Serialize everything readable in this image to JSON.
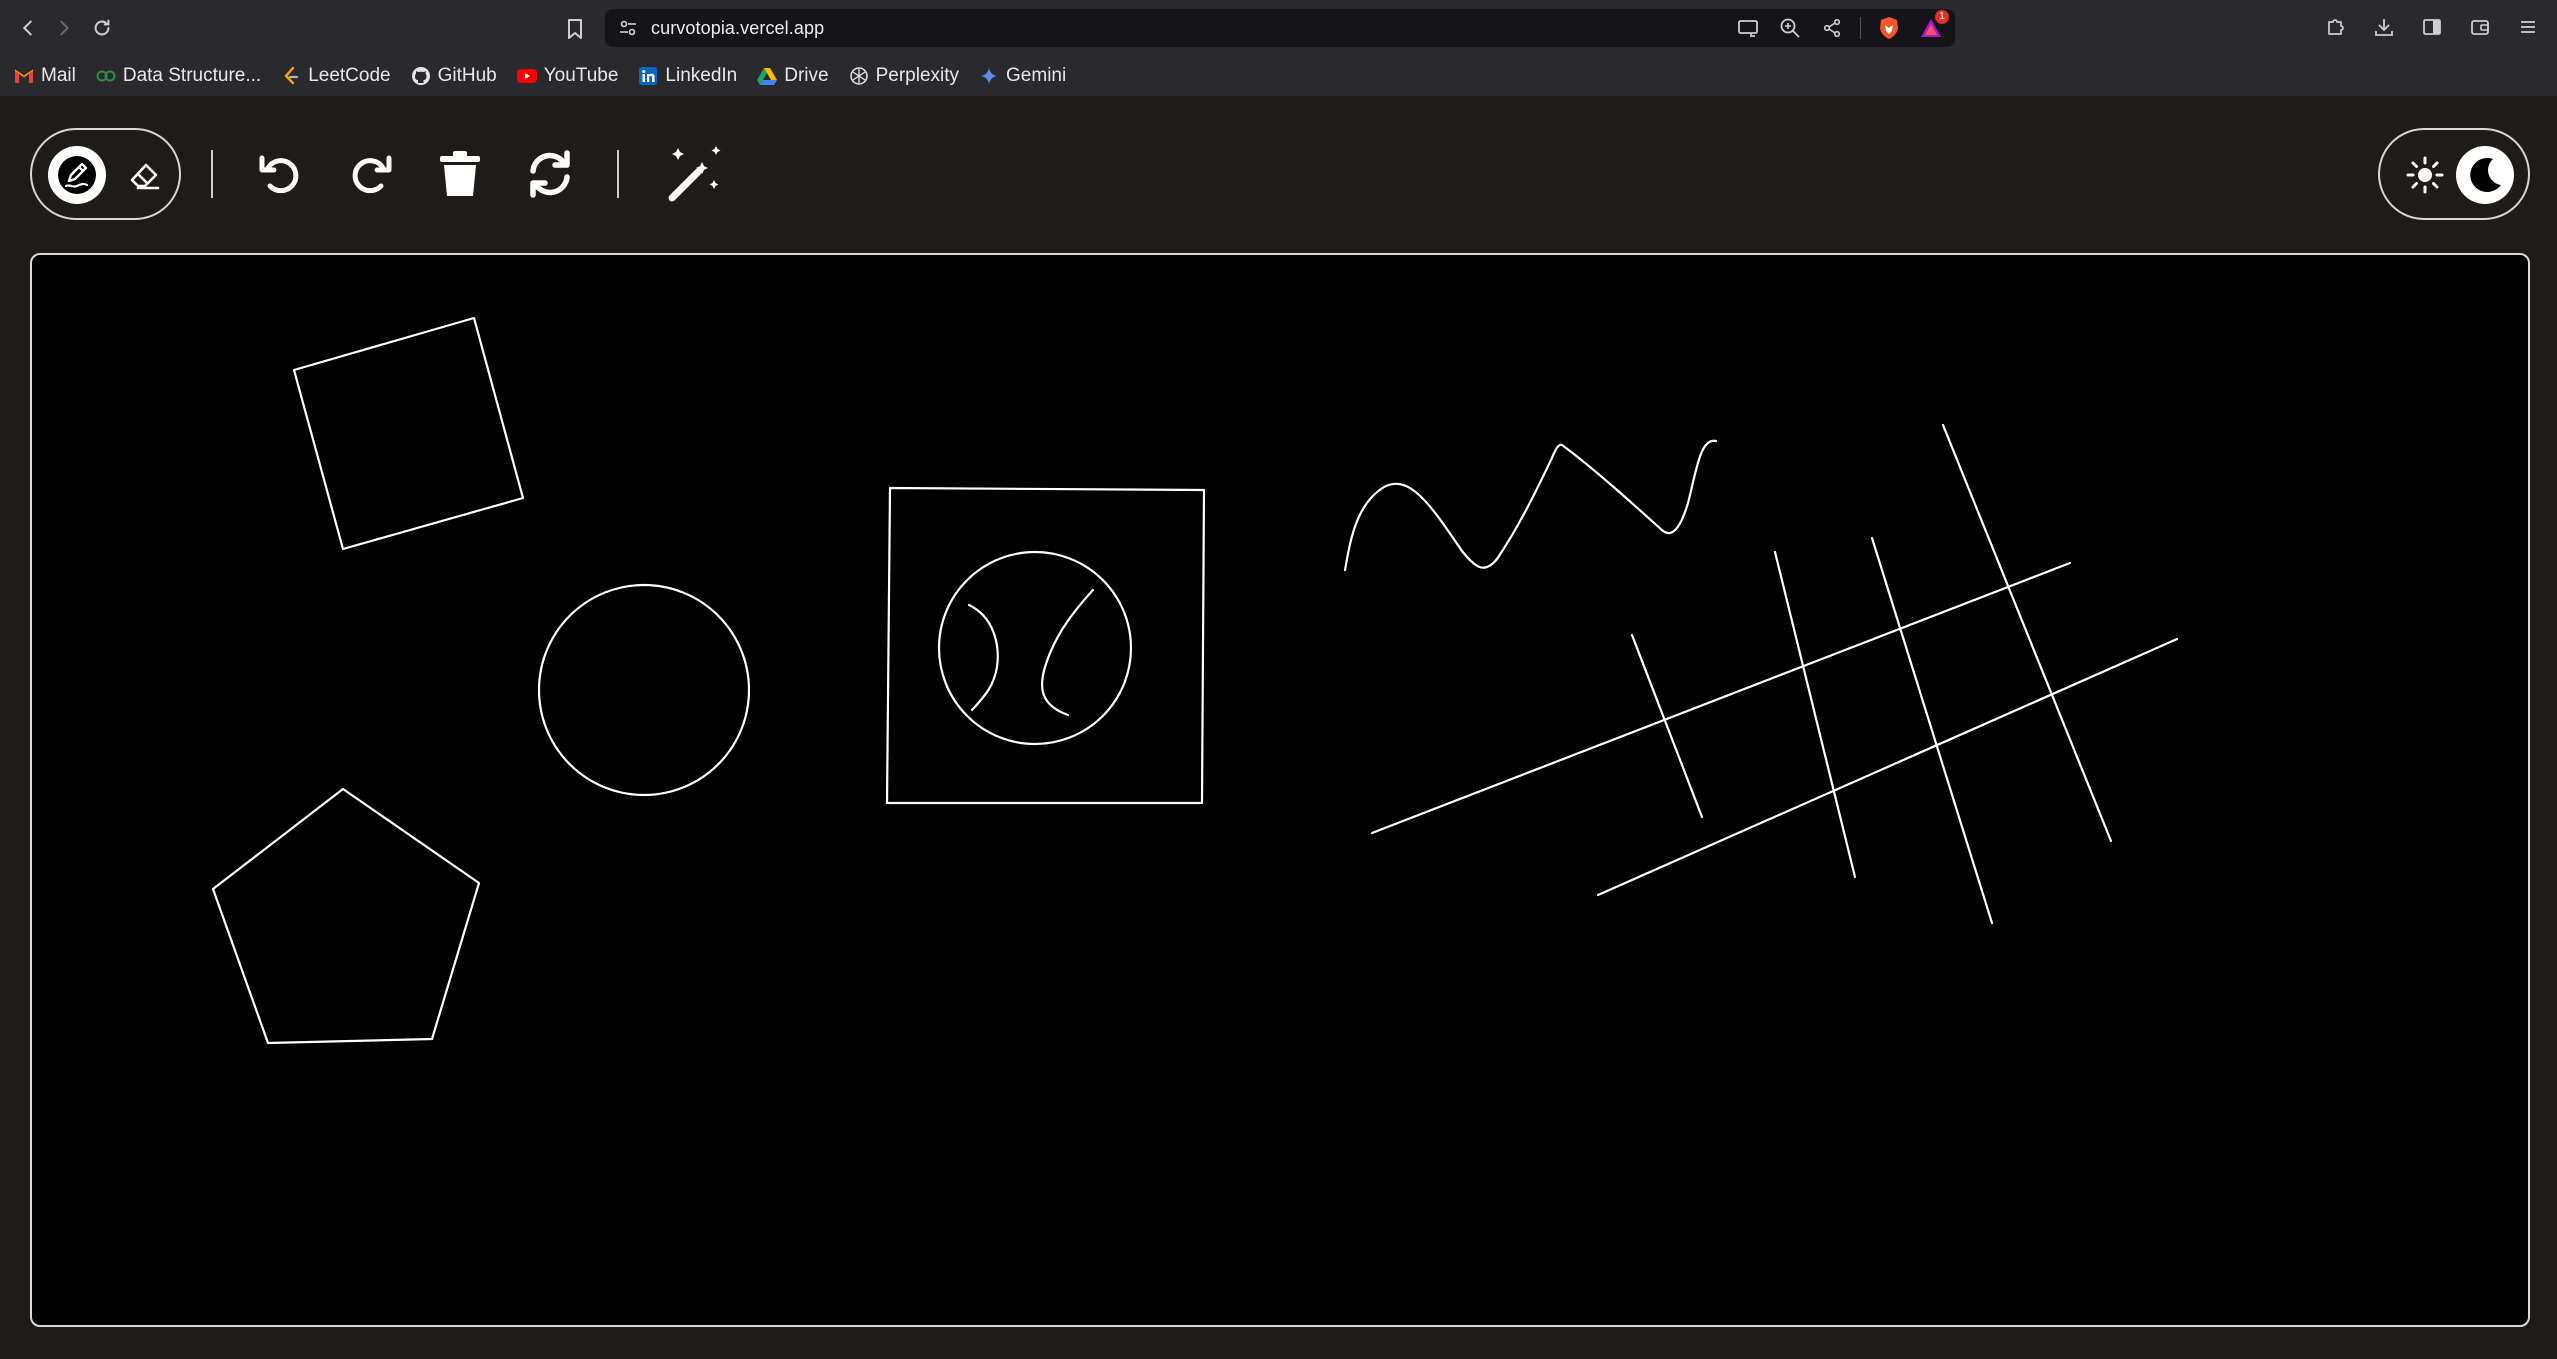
{
  "browser": {
    "url": "curvotopia.vercel.app",
    "extension_badge_count": "1"
  },
  "bookmarks": [
    {
      "label": "Mail",
      "icon": "gmail-icon"
    },
    {
      "label": "Data Structure...",
      "icon": "gfg-icon"
    },
    {
      "label": "LeetCode",
      "icon": "leetcode-icon"
    },
    {
      "label": "GitHub",
      "icon": "github-icon"
    },
    {
      "label": "YouTube",
      "icon": "youtube-icon"
    },
    {
      "label": "LinkedIn",
      "icon": "linkedin-icon"
    },
    {
      "label": "Drive",
      "icon": "drive-icon"
    },
    {
      "label": "Perplexity",
      "icon": "perplexity-icon"
    },
    {
      "label": "Gemini",
      "icon": "gemini-icon"
    }
  ],
  "toolbar": {
    "mode_selected": "draw",
    "tools": [
      "draw-icon",
      "eraser-icon",
      "undo-icon",
      "redo-icon",
      "trash-icon",
      "refresh-icon",
      "magic-wand-icon"
    ],
    "theme_selected": "dark"
  },
  "colors": {
    "canvas_bg": "#000000",
    "page_bg": "#1f1b19",
    "stroke": "#ffffff",
    "browser_chrome": "#2a2a2e"
  }
}
